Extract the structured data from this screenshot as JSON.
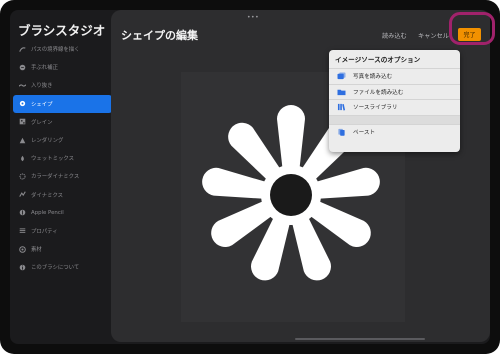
{
  "app_title": "ブラシスタジオ",
  "sidebar": {
    "items": [
      {
        "label": "パスの境界線を描く",
        "icon": "stroke-path-icon",
        "active": false
      },
      {
        "label": "手ぶれ補正",
        "icon": "stabilization-icon",
        "active": false
      },
      {
        "label": "入り抜き",
        "icon": "taper-icon",
        "active": false
      },
      {
        "label": "シェイプ",
        "icon": "shape-icon",
        "active": true
      },
      {
        "label": "グレイン",
        "icon": "grain-icon",
        "active": false
      },
      {
        "label": "レンダリング",
        "icon": "rendering-icon",
        "active": false
      },
      {
        "label": "ウェットミックス",
        "icon": "wet-mix-icon",
        "active": false
      },
      {
        "label": "カラーダイナミクス",
        "icon": "color-dynamics-icon",
        "active": false
      },
      {
        "label": "ダイナミクス",
        "icon": "dynamics-icon",
        "active": false
      },
      {
        "label": "Apple Pencil",
        "icon": "apple-pencil-icon",
        "active": false
      },
      {
        "label": "プロパティ",
        "icon": "properties-icon",
        "active": false
      },
      {
        "label": "素材",
        "icon": "materials-icon",
        "active": false
      },
      {
        "label": "このブラシについて",
        "icon": "about-icon",
        "active": false
      }
    ]
  },
  "sheet": {
    "grabber": "•••",
    "title": "シェイプの編集",
    "import_label": "読み込む",
    "cancel_label": "キャンセル",
    "done_label": "完了"
  },
  "popover": {
    "title": "イメージソースのオプション",
    "items": [
      {
        "label": "写真を読み込む",
        "icon": "photo-import-icon"
      },
      {
        "label": "ファイルを読み込む",
        "icon": "folder-icon"
      },
      {
        "label": "ソースライブラリ",
        "icon": "source-library-icon"
      }
    ],
    "paste_label": "ペースト",
    "paste_icon": "paste-icon"
  },
  "colors": {
    "accent_blue": "#1a73e8",
    "done_orange": "#f29100",
    "highlight_magenta": "#a0226b",
    "icon_blue": "#2f6fe0"
  }
}
